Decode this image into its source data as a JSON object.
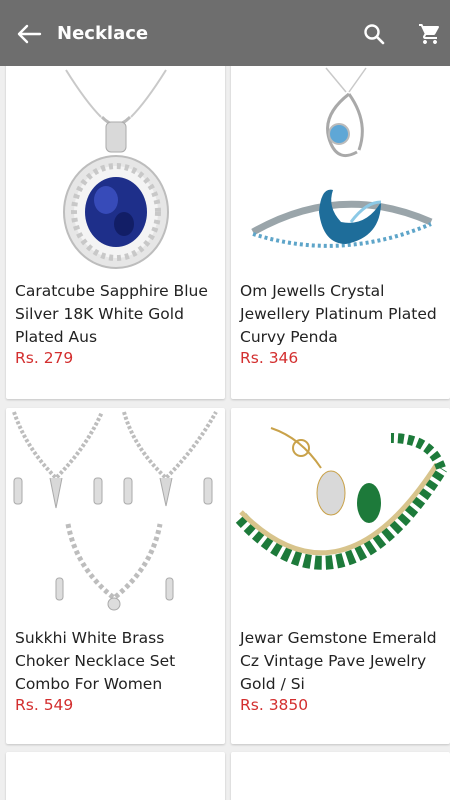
{
  "appbar": {
    "title": "Necklace",
    "back_icon": "arrow-back-icon",
    "search_icon": "search-icon",
    "cart_icon": "cart-icon"
  },
  "products": [
    {
      "name": "Caratcube Sapphire Blue Silver 18K White Gold Plated Aus",
      "price": "Rs. 279"
    },
    {
      "name": "Om Jewells Crystal Jewellery Platinum Plated Curvy Penda",
      "price": "Rs. 346"
    },
    {
      "name": "Sukkhi White Brass Choker Necklace Set Combo For Women",
      "price": "Rs. 549"
    },
    {
      "name": "Jewar Gemstone Emerald Cz Vintage Pave Jewelry Gold / Si",
      "price": "Rs. 3850"
    }
  ],
  "colors": {
    "appbar": "#6e6e6e",
    "price": "#d32f2f"
  }
}
